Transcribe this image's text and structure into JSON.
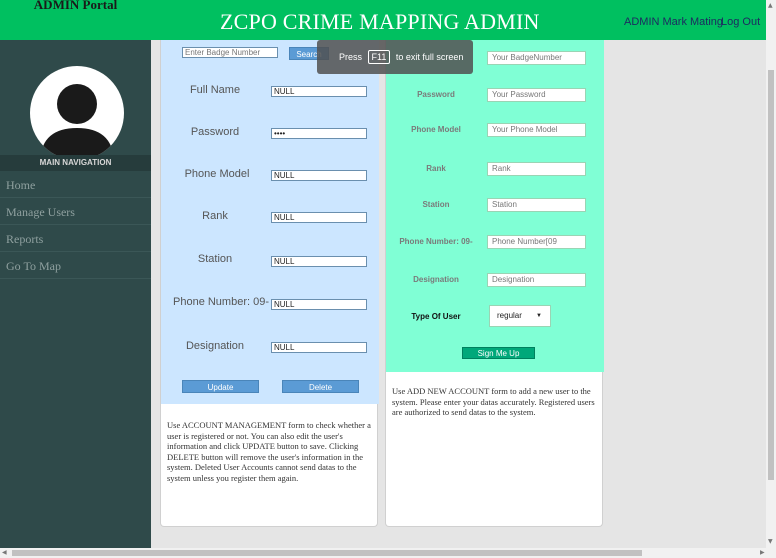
{
  "header": {
    "brand": "ADMIN Portal",
    "title": "ZCPO CRIME MAPPING ADMIN",
    "admin_name": "ADMIN Mark Mating",
    "logout": "Log Out",
    "accent_color": "#00c060"
  },
  "sidebar": {
    "nav_header": "MAIN NAVIGATION",
    "items": [
      {
        "label": "Home"
      },
      {
        "label": "Manage Users"
      },
      {
        "label": "Reports"
      },
      {
        "label": "Go To Map"
      }
    ]
  },
  "fullscreen_notice": {
    "press": "Press",
    "key": "F11",
    "text": "to exit full screen"
  },
  "account_management": {
    "search_placeholder": "Enter Badge Number",
    "search_button": "Search",
    "fields": [
      {
        "label": "Full Name",
        "value": "NULL"
      },
      {
        "label": "Password",
        "value": "••••"
      },
      {
        "label": "Phone Model",
        "value": "NULL"
      },
      {
        "label": "Rank",
        "value": "NULL"
      },
      {
        "label": "Station",
        "value": "NULL"
      },
      {
        "label": "Phone Number: 09-",
        "value": "NULL"
      },
      {
        "label": "Designation",
        "value": "NULL"
      }
    ],
    "update_button": "Update",
    "delete_button": "Delete",
    "description": "Use ACCOUNT MANAGEMENT form to check whether a user is registered or not. You can also edit the user's information and click UPDATE button to save. Clicking DELETE button will remove the user's information in the system. Deleted User Accounts cannot send datas to the system unless you register them again."
  },
  "add_account": {
    "fields": [
      {
        "label": "Password",
        "placeholder": "Your Password"
      },
      {
        "label": "Phone Model",
        "placeholder": "Your Phone Model"
      },
      {
        "label": "Rank",
        "placeholder": "Rank"
      },
      {
        "label": "Station",
        "placeholder": "Station"
      },
      {
        "label": "Phone Number: 09-",
        "placeholder": "Phone Number[09"
      },
      {
        "label": "Designation",
        "placeholder": "Designation"
      }
    ],
    "badge_placeholder": "Your BadgeNumber",
    "type_label": "Type Of User",
    "type_value": "regular",
    "signup_button": "Sign Me Up",
    "description": "Use ADD NEW ACCOUNT form to add a new user to the system. Please enter your datas accurately. Registered users are authorized to send datas to the system."
  }
}
